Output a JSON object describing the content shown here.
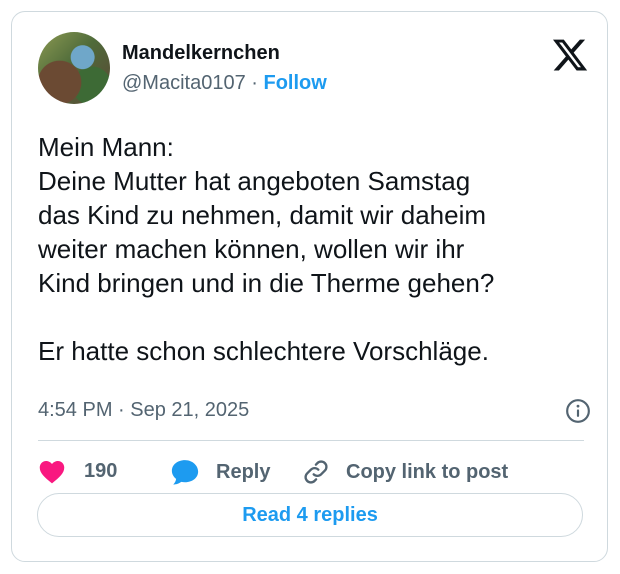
{
  "author": {
    "name": "Mandelkernchen",
    "handle": "@Macita0107",
    "separator": "·",
    "follow_label": "Follow"
  },
  "tweet": {
    "lines": [
      "Mein Mann:",
      "Deine Mutter hat angeboten Samstag",
      "das Kind zu nehmen, damit wir daheim",
      "weiter machen können, wollen wir ihr",
      "Kind bringen und in die Therme gehen?",
      "Er hatte schon schlechtere Vorschläge."
    ],
    "timestamp": "4:54 PM · Sep 21, 2025"
  },
  "actions": {
    "like_count": "190",
    "reply_label": "Reply",
    "copy_label": "Copy link to post"
  },
  "read_replies_label": "Read 4 replies",
  "colors": {
    "accent": "#1d9bf0",
    "like": "#f91880",
    "text": "#0f1419",
    "muted": "#536471",
    "border": "#cfd9de"
  },
  "icons": [
    "x-logo-icon",
    "info-icon",
    "heart-icon",
    "reply-bubble-icon",
    "link-icon"
  ]
}
